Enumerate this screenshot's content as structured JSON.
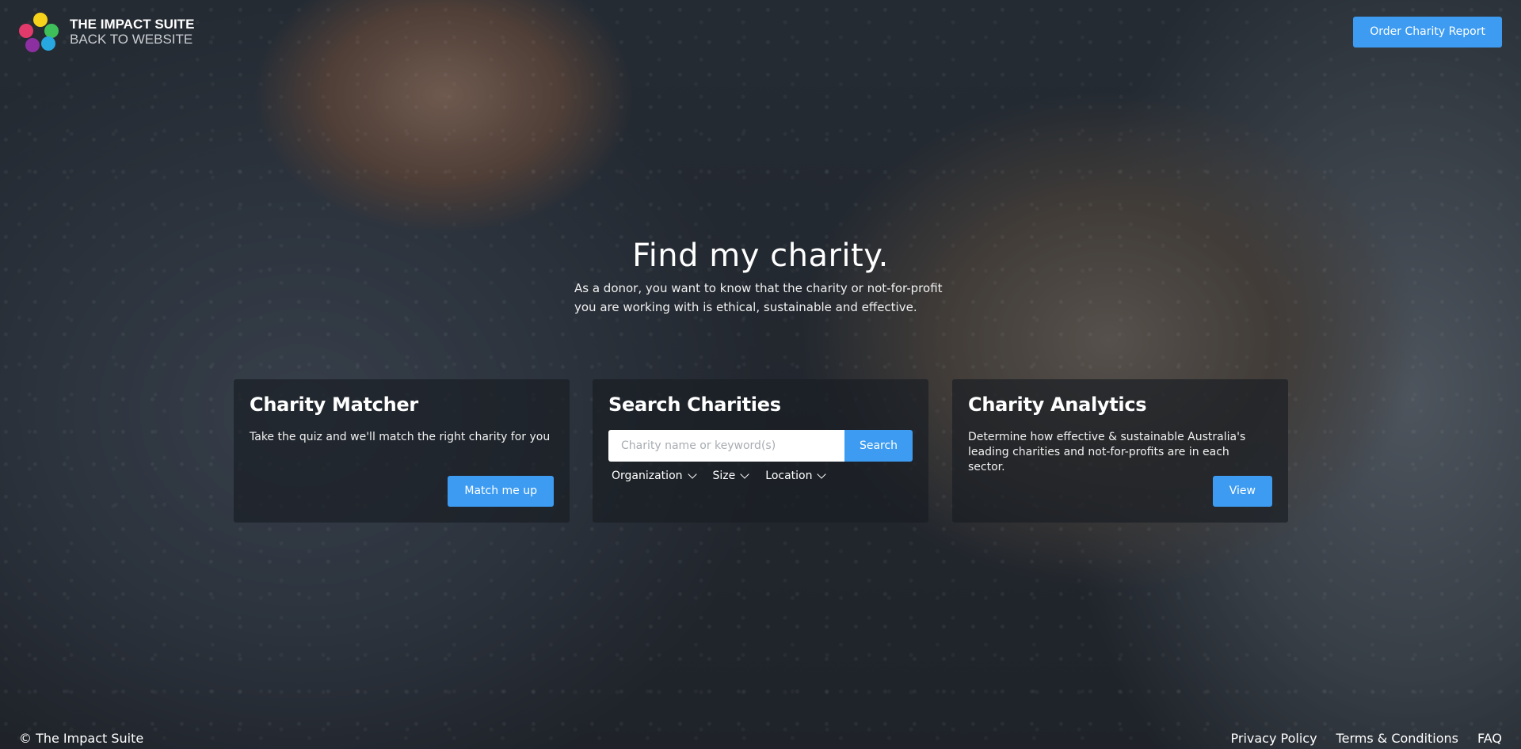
{
  "header": {
    "brand_title": "THE IMPACT SUITE",
    "brand_sub": "BACK TO WEBSITE",
    "order_label": "Order Charity Report"
  },
  "hero": {
    "title": "Find my charity.",
    "subtitle": "As a donor, you want to know that the charity or not-for-profit you are working with is ethical, sustainable and effective."
  },
  "matcher": {
    "title": "Charity Matcher",
    "desc": "Take the quiz and we'll match the right charity for you",
    "button": "Match me up"
  },
  "search": {
    "title": "Search Charities",
    "placeholder": "Charity name or keyword(s)",
    "button": "Search",
    "filters": [
      "Organization",
      "Size",
      "Location"
    ]
  },
  "analytics": {
    "title": "Charity Analytics",
    "desc": "Determine how effective & sustainable Australia's leading charities and not-for-profits are in each sector.",
    "button": "View"
  },
  "footer": {
    "copyright": "© The Impact Suite",
    "links": [
      "Privacy Policy",
      "Terms & Conditions",
      "FAQ"
    ]
  },
  "colors": {
    "accent": "#3d9cf2",
    "card_bg": "rgba(25,29,35,0.68)"
  }
}
